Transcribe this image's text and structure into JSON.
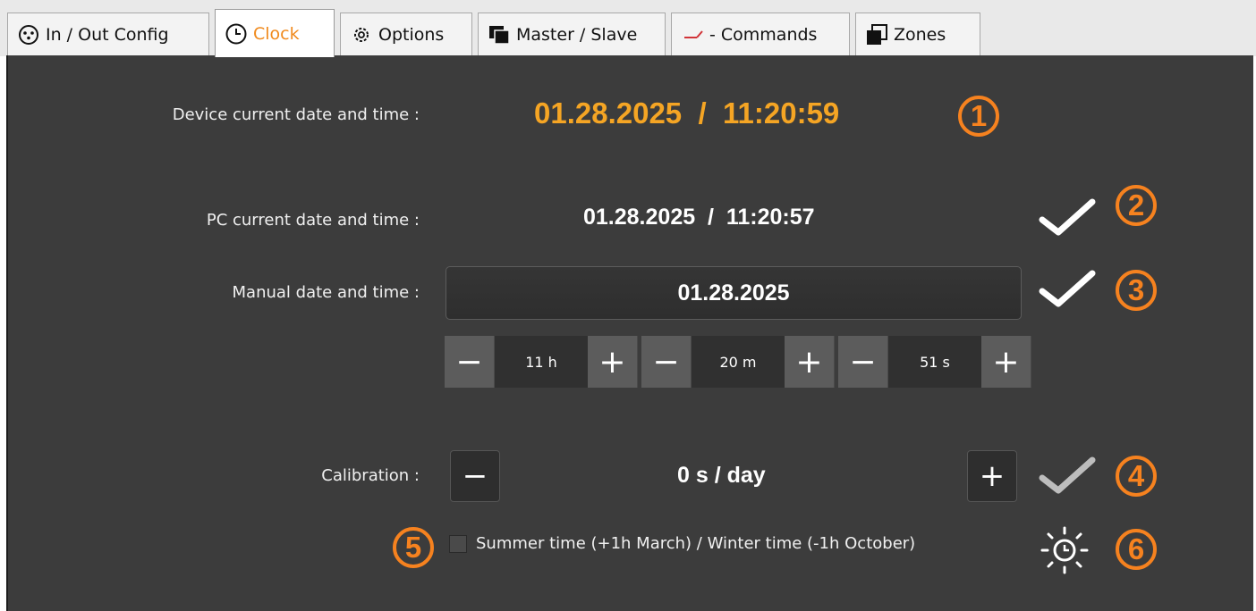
{
  "tabs": [
    {
      "label": "In / Out Config",
      "icon": "connector-icon",
      "active": false
    },
    {
      "label": "Clock",
      "icon": "clock-icon",
      "active": true
    },
    {
      "label": "Options",
      "icon": "gear-icon",
      "active": false
    },
    {
      "label": "Master / Slave",
      "icon": "stacked-windows-icon",
      "active": false
    },
    {
      "label": "- Commands",
      "icon": "check-dash-icon",
      "active": false
    },
    {
      "label": "Zones",
      "icon": "zones-icon",
      "active": false
    }
  ],
  "device": {
    "label": "Device current date and time :",
    "value": "01.28.2025  /  11:20:59"
  },
  "pc": {
    "label": "PC current date and time :",
    "value": "01.28.2025  /  11:20:57"
  },
  "manual": {
    "label": "Manual date and time :",
    "date": "01.28.2025"
  },
  "stepper": {
    "hours": "11 h",
    "minutes": "20 m",
    "seconds": "51 s",
    "minus": "−",
    "plus": "+"
  },
  "calibration": {
    "label": "Calibration :",
    "value": "0 s / day",
    "minus": "−",
    "plus": "+"
  },
  "summer_time": {
    "label": "Summer time (+1h March) / Winter time (-1h October)",
    "checked": false
  },
  "badges": [
    "1",
    "2",
    "3",
    "4",
    "5",
    "6"
  ],
  "colors": {
    "accent": "#f6821f",
    "device_time": "#f5a524",
    "panel": "#3c3c3c",
    "active_tab_text": "#f08a1d"
  }
}
